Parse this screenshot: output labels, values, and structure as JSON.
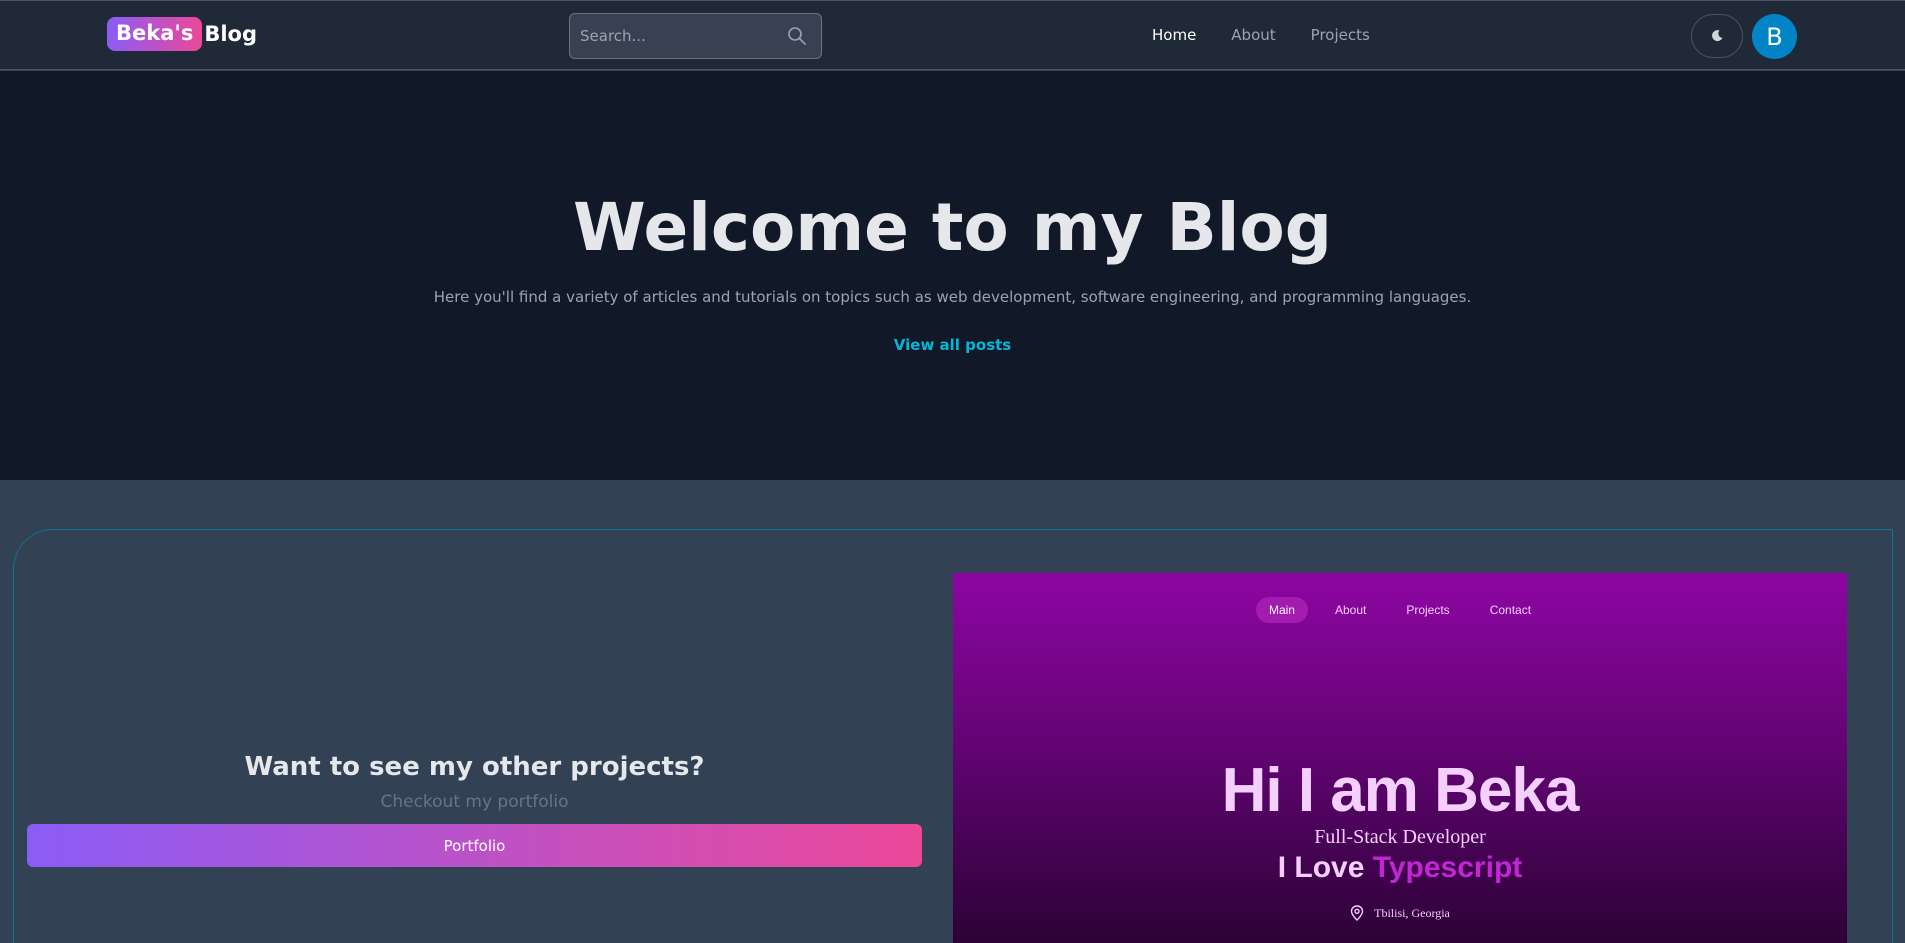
{
  "navbar": {
    "brand_badge": "Beka's",
    "brand_text": "Blog",
    "search_placeholder": "Search...",
    "links": [
      {
        "label": "Home",
        "active": true
      },
      {
        "label": "About",
        "active": false
      },
      {
        "label": "Projects",
        "active": false
      }
    ],
    "avatar_initial": "B",
    "theme_icon": "moon-icon"
  },
  "hero": {
    "title": "Welcome to my Blog",
    "subtitle": "Here you'll find a variety of articles and tutorials on topics such as web development, software engineering, and programming languages.",
    "link_label": "View all posts"
  },
  "projects": {
    "title": "Want to see my other projects?",
    "subtitle": "Checkout my portfolio",
    "button_label": "Portfolio"
  },
  "preview": {
    "nav": [
      "Main",
      "About",
      "Projects",
      "Contact"
    ],
    "title": "Hi I am Beka",
    "role": "Full-Stack Developer",
    "love_prefix": "I Love",
    "love_accent": "Typescript",
    "location": "Tbilisi, Georgia"
  },
  "colors": {
    "accent_gradient_start": "#8b5cf6",
    "accent_gradient_end": "#ec4899",
    "link": "#06b6d4",
    "avatar": "#0284c7"
  }
}
